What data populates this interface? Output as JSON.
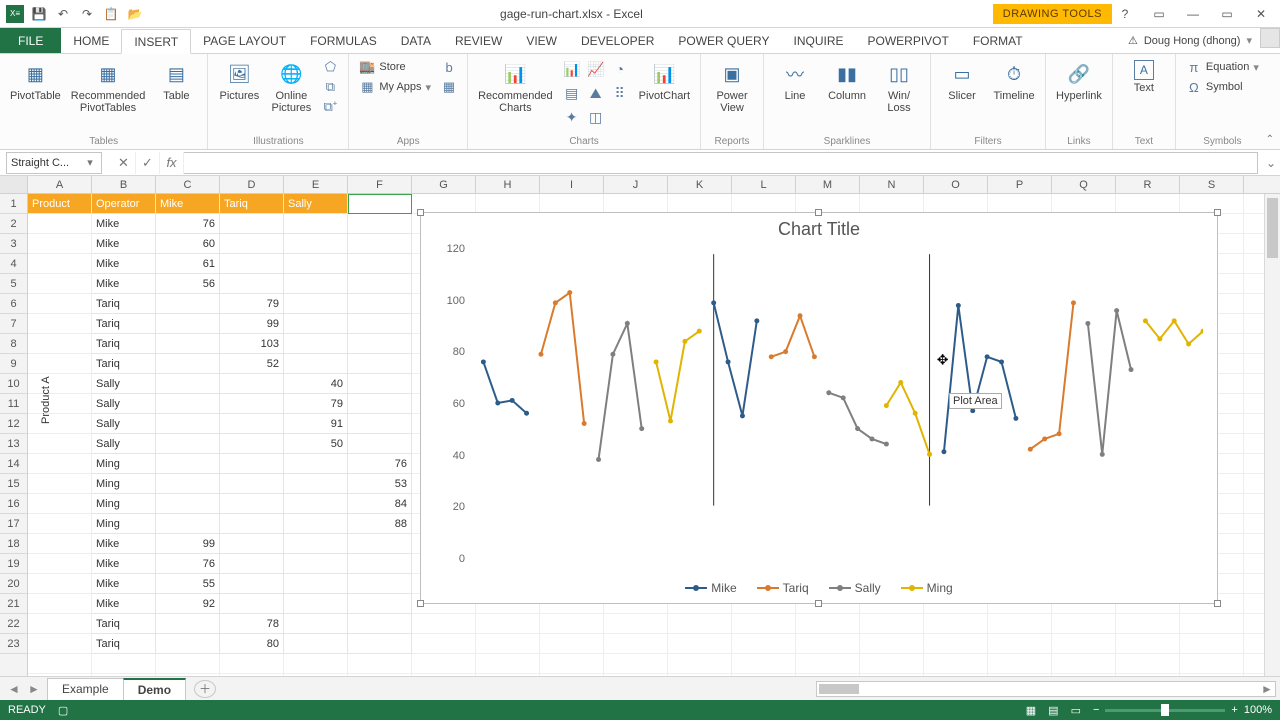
{
  "app": {
    "title": "gage-run-chart.xlsx - Excel",
    "context_tab": "DRAWING TOOLS"
  },
  "qat": {
    "save": "💾",
    "undo": "↶",
    "redo": "↷",
    "touch": "📋",
    "open": "📂"
  },
  "user": {
    "name": "Doug Hong (dhong)",
    "warn": "⚠"
  },
  "window_buttons": {
    "help": "?",
    "ribbonopts": "▭",
    "min": "—",
    "restore": "▭",
    "close": "✕"
  },
  "tabs": {
    "file": "FILE",
    "list": [
      "HOME",
      "INSERT",
      "PAGE LAYOUT",
      "FORMULAS",
      "DATA",
      "REVIEW",
      "VIEW",
      "DEVELOPER",
      "POWER QUERY",
      "INQUIRE",
      "POWERPIVOT",
      "FORMAT"
    ],
    "active": "INSERT"
  },
  "ribbon": {
    "tables": {
      "label": "Tables",
      "pivot": "PivotTable",
      "recpivot": "Recommended\nPivotTables",
      "table": "Table"
    },
    "illus": {
      "label": "Illustrations",
      "pictures": "Pictures",
      "online": "Online\nPictures",
      "shapes": "⬠",
      "smartart": "⧉",
      "scr": "⧉⁺"
    },
    "apps": {
      "label": "Apps",
      "store": "Store",
      "myapps": "My Apps",
      "bing": "b",
      "people": "▦"
    },
    "charts": {
      "label": "Charts",
      "rec": "Recommended\nCharts",
      "pivotchart": "PivotChart"
    },
    "reports": {
      "label": "Reports",
      "powerview": "Power\nView"
    },
    "spark": {
      "label": "Sparklines",
      "line": "Line",
      "column": "Column",
      "winloss": "Win/\nLoss"
    },
    "filters": {
      "label": "Filters",
      "slicer": "Slicer",
      "timeline": "Timeline"
    },
    "links": {
      "label": "Links",
      "hyperlink": "Hyperlink"
    },
    "text": {
      "label": "Text",
      "text": "Text"
    },
    "symbols": {
      "label": "Symbols",
      "equation": "Equation",
      "symbol": "Symbol",
      "pi": "π",
      "omega": "Ω"
    }
  },
  "formula": {
    "namebox": "Straight C...",
    "fx": "fx"
  },
  "columns": [
    "A",
    "B",
    "C",
    "D",
    "E",
    "F",
    "G",
    "H",
    "I",
    "J",
    "K",
    "L",
    "M",
    "N",
    "O",
    "P",
    "Q",
    "R",
    "S"
  ],
  "row_count": 23,
  "table": {
    "headers": [
      "Product",
      "Operator",
      "Mike",
      "Tariq",
      "Sally",
      "Ming"
    ],
    "product_a": "Product A",
    "rows": [
      {
        "op": "Mike",
        "vals": [
          76,
          null,
          null,
          null
        ]
      },
      {
        "op": "Mike",
        "vals": [
          60,
          null,
          null,
          null
        ]
      },
      {
        "op": "Mike",
        "vals": [
          61,
          null,
          null,
          null
        ]
      },
      {
        "op": "Mike",
        "vals": [
          56,
          null,
          null,
          null
        ]
      },
      {
        "op": "Tariq",
        "vals": [
          null,
          79,
          null,
          null
        ]
      },
      {
        "op": "Tariq",
        "vals": [
          null,
          99,
          null,
          null
        ]
      },
      {
        "op": "Tariq",
        "vals": [
          null,
          103,
          null,
          null
        ]
      },
      {
        "op": "Tariq",
        "vals": [
          null,
          52,
          null,
          null
        ]
      },
      {
        "op": "Sally",
        "vals": [
          null,
          null,
          40,
          null
        ]
      },
      {
        "op": "Sally",
        "vals": [
          null,
          null,
          79,
          null
        ]
      },
      {
        "op": "Sally",
        "vals": [
          null,
          null,
          91,
          null
        ]
      },
      {
        "op": "Sally",
        "vals": [
          null,
          null,
          50,
          null
        ]
      },
      {
        "op": "Ming",
        "vals": [
          null,
          null,
          null,
          76
        ]
      },
      {
        "op": "Ming",
        "vals": [
          null,
          null,
          null,
          53
        ]
      },
      {
        "op": "Ming",
        "vals": [
          null,
          null,
          null,
          84
        ]
      },
      {
        "op": "Ming",
        "vals": [
          null,
          null,
          null,
          88
        ]
      },
      {
        "op": "Mike",
        "vals": [
          99,
          null,
          null,
          null
        ]
      },
      {
        "op": "Mike",
        "vals": [
          76,
          null,
          null,
          null
        ]
      },
      {
        "op": "Mike",
        "vals": [
          55,
          null,
          null,
          null
        ]
      },
      {
        "op": "Mike",
        "vals": [
          92,
          null,
          null,
          null
        ]
      },
      {
        "op": "Tariq",
        "vals": [
          null,
          78,
          null,
          null
        ]
      },
      {
        "op": "Tariq",
        "vals": [
          null,
          80,
          null,
          null
        ]
      }
    ]
  },
  "chart_data": {
    "type": "line",
    "title": "Chart Title",
    "ylim": [
      0,
      120
    ],
    "yticks": [
      0,
      20,
      40,
      60,
      80,
      100,
      120
    ],
    "xcount": 48,
    "tooltip": "Plot Area",
    "vlines_x": [
      17,
      32
    ],
    "colors": {
      "Mike": "#2e5c8a",
      "Tariq": "#d97b2e",
      "Sally": "#7f7f7f",
      "Ming": "#e0b400"
    },
    "series": [
      {
        "name": "Mike",
        "segments": [
          {
            "x0": 1,
            "y": [
              76,
              60,
              61,
              56
            ]
          },
          {
            "x0": 17,
            "y": [
              99,
              76,
              55,
              92
            ]
          },
          {
            "x0": 33,
            "y": [
              41,
              98,
              57,
              78,
              76,
              54
            ]
          }
        ]
      },
      {
        "name": "Tariq",
        "segments": [
          {
            "x0": 5,
            "y": [
              79,
              99,
              103,
              52
            ]
          },
          {
            "x0": 21,
            "y": [
              78,
              80,
              94,
              78
            ]
          },
          {
            "x0": 39,
            "y": [
              42,
              46,
              48,
              99
            ]
          }
        ]
      },
      {
        "name": "Sally",
        "segments": [
          {
            "x0": 9,
            "y": [
              38,
              79,
              91,
              50
            ]
          },
          {
            "x0": 25,
            "y": [
              64,
              62,
              50,
              46,
              44
            ]
          },
          {
            "x0": 43,
            "y": [
              91,
              40,
              96,
              73
            ]
          }
        ]
      },
      {
        "name": "Ming",
        "segments": [
          {
            "x0": 13,
            "y": [
              76,
              53,
              84,
              88
            ]
          },
          {
            "x0": 29,
            "y": [
              59,
              68,
              56,
              40
            ]
          },
          {
            "x0": 47,
            "y": [
              92,
              85,
              92,
              83,
              88
            ]
          }
        ]
      }
    ],
    "legend": [
      "Mike",
      "Tariq",
      "Sally",
      "Ming"
    ]
  },
  "sheets": {
    "tabs": [
      "Example",
      "Demo"
    ],
    "active": "Demo"
  },
  "status": {
    "ready": "READY",
    "zoom": "100%"
  }
}
